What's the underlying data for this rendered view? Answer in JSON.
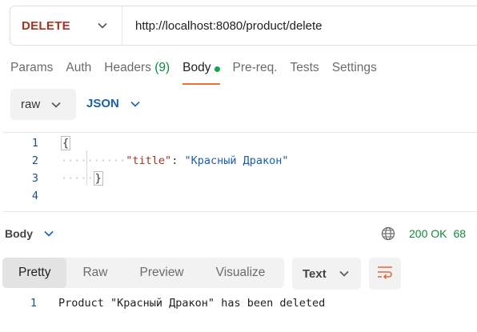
{
  "request": {
    "method": "DELETE",
    "url": "http://localhost:8080/product/delete"
  },
  "tabs": [
    {
      "label": "Params"
    },
    {
      "label": "Auth"
    },
    {
      "label": "Headers",
      "count": "(9)"
    },
    {
      "label": "Body",
      "active": true
    },
    {
      "label": "Pre-req."
    },
    {
      "label": "Tests"
    },
    {
      "label": "Settings"
    }
  ],
  "body_options": {
    "type": "raw",
    "language": "JSON"
  },
  "editor": {
    "lines": [
      {
        "num": "1",
        "text": "{"
      },
      {
        "num": "2",
        "key": "\"title\"",
        "colon": ": ",
        "value": "\"Красный Дракон\""
      },
      {
        "num": "3",
        "text": "}"
      },
      {
        "num": "4",
        "text": ""
      }
    ]
  },
  "response": {
    "label": "Body",
    "status": "200 OK",
    "time": "68",
    "view_tabs": [
      "Pretty",
      "Raw",
      "Preview",
      "Visualize"
    ],
    "active_view": "Pretty",
    "format": "Text",
    "lines": [
      {
        "num": "1",
        "text": "Product \"Красный Дракон\" has been deleted"
      }
    ]
  },
  "colors": {
    "method": "#a8321f",
    "status_ok": "#0f8a3a",
    "active_tab_underline": "#f26b3a",
    "language": "#1b5fb3",
    "wrap_icon": "#e06a3a"
  },
  "icons": {
    "dropdown": "chevron-down-icon",
    "network": "globe-icon",
    "wrap": "wrap-lines-icon"
  }
}
